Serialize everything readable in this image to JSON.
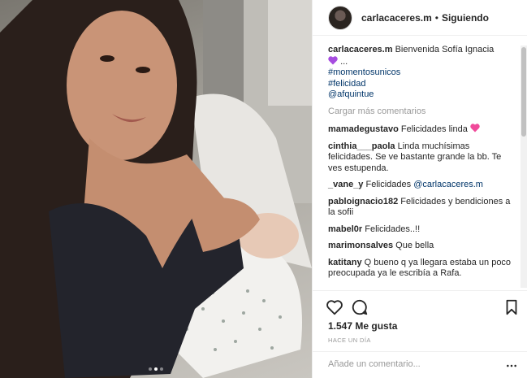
{
  "header": {
    "username": "carlacaceres.m",
    "separator": "•",
    "follow_status": "Siguiendo"
  },
  "caption": {
    "username": "carlacaceres.m",
    "text": "Bienvenida Sofía Ignacia",
    "ellipsis": "...",
    "hashtags": [
      "#momentosunicos",
      "#felicidad"
    ],
    "mention": "@afquintue"
  },
  "load_more": "Cargar más comentarios",
  "comments": [
    {
      "user": "mamadegustavo",
      "text": "Felicidades linda"
    },
    {
      "user": "cinthia___paola",
      "text": "Linda muchísimas felicidades. Se ve bastante grande la bb. Te ves estupenda."
    },
    {
      "user": "_vane_y",
      "text": "Felicidades",
      "mention": "@carlacaceres.m"
    },
    {
      "user": "pabloignacio182",
      "text": "Felicidades y bendiciones a la sofii"
    },
    {
      "user": "mabel0r",
      "text": "Felicidades..!!"
    },
    {
      "user": "marimonsalves",
      "text": "Que bella"
    },
    {
      "user": "katitany",
      "text": "Q bueno q ya llegara estaba un poco preocupada ya le escribía a Rafa."
    }
  ],
  "likes": "1.547 Me gusta",
  "time": "HACE UN DÍA",
  "add_comment_placeholder": "Añade un comentario...",
  "icons": [
    "heart-icon",
    "comment-icon",
    "bookmark-icon",
    "more-options-icon",
    "purple-heart-emoji",
    "pink-hearts-emoji"
  ],
  "colors": {
    "link": "#003569",
    "muted": "#999999",
    "text": "#262626",
    "border": "#efefef"
  },
  "carousel": {
    "count": 3,
    "active_index": 1
  }
}
